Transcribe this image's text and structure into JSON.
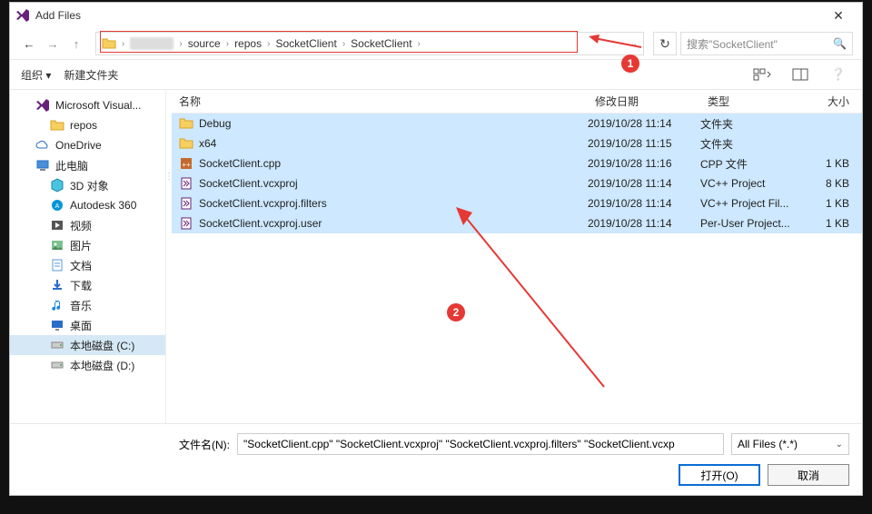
{
  "title": "Add Files",
  "nav": {
    "back": "←",
    "fwd": "→",
    "up": "↑"
  },
  "breadcrumb": {
    "parts": [
      "source",
      "repos",
      "SocketClient",
      "SocketClient"
    ]
  },
  "search": {
    "placeholder": "搜索\"SocketClient\""
  },
  "toolbar": {
    "organize": "组织 ▾",
    "newfolder": "新建文件夹"
  },
  "tree": [
    {
      "icon": "vs",
      "label": "Microsoft Visual..."
    },
    {
      "icon": "fld",
      "label": "repos",
      "indent": true
    },
    {
      "icon": "cloud",
      "label": "OneDrive"
    },
    {
      "icon": "pc",
      "label": "此电脑"
    },
    {
      "icon": "cube",
      "label": "3D 对象",
      "indent": true
    },
    {
      "icon": "a360",
      "label": "Autodesk 360",
      "indent": true
    },
    {
      "icon": "vid",
      "label": "视频",
      "indent": true
    },
    {
      "icon": "img",
      "label": "图片",
      "indent": true
    },
    {
      "icon": "doc",
      "label": "文档",
      "indent": true
    },
    {
      "icon": "dl",
      "label": "下载",
      "indent": true
    },
    {
      "icon": "mus",
      "label": "音乐",
      "indent": true
    },
    {
      "icon": "desk",
      "label": "桌面",
      "indent": true
    },
    {
      "icon": "disk",
      "label": "本地磁盘 (C:)",
      "indent": true,
      "sel": true
    },
    {
      "icon": "disk",
      "label": "本地磁盘 (D:)",
      "indent": true
    }
  ],
  "columns": {
    "name": "名称",
    "date": "修改日期",
    "type": "类型",
    "size": "大小"
  },
  "rows": [
    {
      "ico": "fld",
      "name": "Debug",
      "date": "2019/10/28 11:14",
      "type": "文件夹",
      "size": ""
    },
    {
      "ico": "fld",
      "name": "x64",
      "date": "2019/10/28 11:15",
      "type": "文件夹",
      "size": ""
    },
    {
      "ico": "cpp",
      "name": "SocketClient.cpp",
      "date": "2019/10/28 11:16",
      "type": "CPP 文件",
      "size": "1 KB"
    },
    {
      "ico": "proj",
      "name": "SocketClient.vcxproj",
      "date": "2019/10/28 11:14",
      "type": "VC++ Project",
      "size": "8 KB"
    },
    {
      "ico": "proj",
      "name": "SocketClient.vcxproj.filters",
      "date": "2019/10/28 11:14",
      "type": "VC++ Project Fil...",
      "size": "1 KB"
    },
    {
      "ico": "proj",
      "name": "SocketClient.vcxproj.user",
      "date": "2019/10/28 11:14",
      "type": "Per-User Project...",
      "size": "1 KB"
    }
  ],
  "footer": {
    "filelabel": "文件名(N):",
    "filename": "\"SocketClient.cpp\" \"SocketClient.vcxproj\" \"SocketClient.vcxproj.filters\" \"SocketClient.vcxp",
    "filter": "All Files (*.*)",
    "open": "打开(O)",
    "cancel": "取消"
  },
  "annotations": {
    "badge1": "1",
    "badge2": "2"
  }
}
